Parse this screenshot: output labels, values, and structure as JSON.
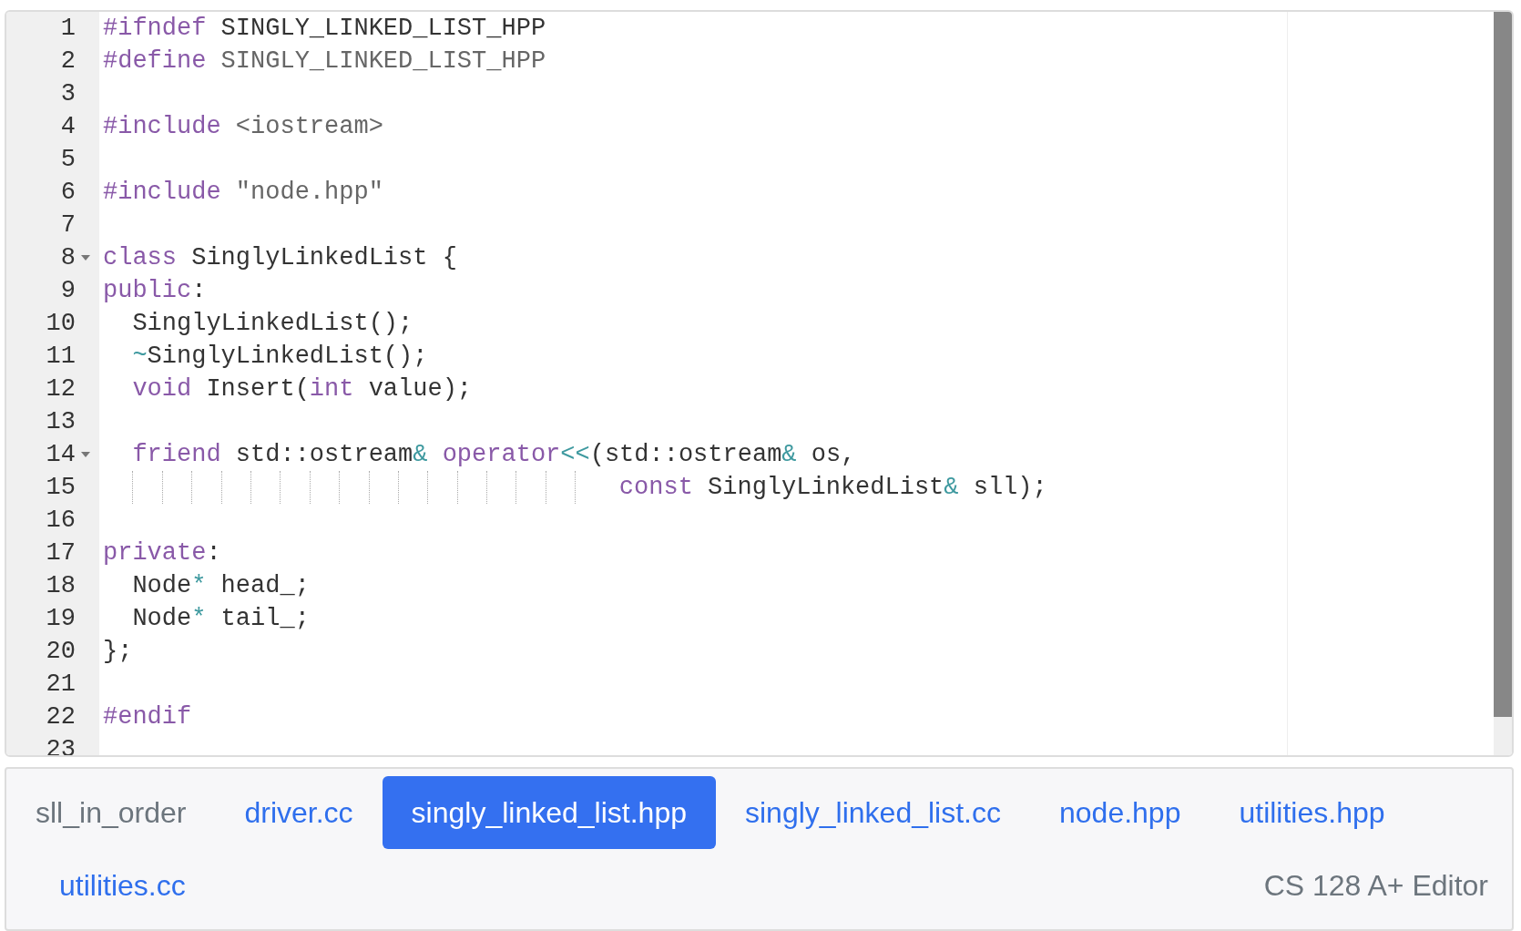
{
  "editor": {
    "lines": [
      {
        "number": "1",
        "fold": false,
        "indent_guides": false,
        "tokens": [
          {
            "kind": "keyword",
            "text": "#ifndef"
          },
          {
            "kind": "plain",
            "text": " SINGLY_LINKED_LIST_HPP"
          }
        ]
      },
      {
        "number": "2",
        "fold": false,
        "indent_guides": false,
        "tokens": [
          {
            "kind": "keyword",
            "text": "#define"
          },
          {
            "kind": "meta",
            "text": " SINGLY_LINKED_LIST_HPP"
          }
        ]
      },
      {
        "number": "3",
        "fold": false,
        "indent_guides": false
      },
      {
        "number": "4",
        "fold": false,
        "indent_guides": false,
        "tokens": [
          {
            "kind": "keyword",
            "text": "#include"
          },
          {
            "kind": "meta",
            "text": " <iostream>"
          }
        ]
      },
      {
        "number": "5",
        "fold": false,
        "indent_guides": false
      },
      {
        "number": "6",
        "fold": false,
        "indent_guides": false,
        "tokens": [
          {
            "kind": "keyword",
            "text": "#include"
          },
          {
            "kind": "meta",
            "text": " \"node.hpp\""
          }
        ]
      },
      {
        "number": "7",
        "fold": false,
        "indent_guides": false
      },
      {
        "number": "8",
        "fold": true,
        "indent_guides": false,
        "tokens": [
          {
            "kind": "keyword",
            "text": "class"
          },
          {
            "kind": "plain",
            "text": " SinglyLinkedList {"
          }
        ]
      },
      {
        "number": "9",
        "fold": false,
        "indent_guides": false,
        "tokens": [
          {
            "kind": "keyword",
            "text": "public"
          },
          {
            "kind": "plain",
            "text": ":"
          }
        ]
      },
      {
        "number": "10",
        "fold": false,
        "indent_guides": false,
        "tokens": [
          {
            "kind": "plain",
            "text": "  SinglyLinkedList();"
          }
        ]
      },
      {
        "number": "11",
        "fold": false,
        "indent_guides": false,
        "tokens": [
          {
            "kind": "operator",
            "text": "  ~"
          },
          {
            "kind": "plain",
            "text": "SinglyLinkedList();"
          }
        ]
      },
      {
        "number": "12",
        "fold": false,
        "indent_guides": false,
        "tokens": [
          {
            "kind": "keyword",
            "text": "  void"
          },
          {
            "kind": "plain",
            "text": " Insert("
          },
          {
            "kind": "keyword",
            "text": "int"
          },
          {
            "kind": "plain",
            "text": " value);"
          }
        ]
      },
      {
        "number": "13",
        "fold": false,
        "indent_guides": false
      },
      {
        "number": "14",
        "fold": true,
        "indent_guides": false,
        "tokens": [
          {
            "kind": "keyword",
            "text": "  friend"
          },
          {
            "kind": "plain",
            "text": " std::ostream"
          },
          {
            "kind": "operator",
            "text": "& "
          },
          {
            "kind": "keyword",
            "text": "operator"
          },
          {
            "kind": "operator",
            "text": "<<"
          },
          {
            "kind": "plain",
            "text": "(std::ostream"
          },
          {
            "kind": "operator",
            "text": "&"
          },
          {
            "kind": "plain",
            "text": " os,"
          }
        ]
      },
      {
        "number": "15",
        "fold": false,
        "indent_guides": true,
        "tokens": [
          {
            "kind": "keyword",
            "text": "                                   const"
          },
          {
            "kind": "plain",
            "text": " SinglyLinkedList"
          },
          {
            "kind": "operator",
            "text": "&"
          },
          {
            "kind": "plain",
            "text": " sll);"
          }
        ]
      },
      {
        "number": "16",
        "fold": false,
        "indent_guides": false
      },
      {
        "number": "17",
        "fold": false,
        "indent_guides": false,
        "tokens": [
          {
            "kind": "keyword",
            "text": "private"
          },
          {
            "kind": "plain",
            "text": ":"
          }
        ]
      },
      {
        "number": "18",
        "fold": false,
        "indent_guides": false,
        "tokens": [
          {
            "kind": "plain",
            "text": "  Node"
          },
          {
            "kind": "operator",
            "text": "*"
          },
          {
            "kind": "plain",
            "text": " head_;"
          }
        ]
      },
      {
        "number": "19",
        "fold": false,
        "indent_guides": false,
        "tokens": [
          {
            "kind": "plain",
            "text": "  Node"
          },
          {
            "kind": "operator",
            "text": "*"
          },
          {
            "kind": "plain",
            "text": " tail_;"
          }
        ]
      },
      {
        "number": "20",
        "fold": false,
        "indent_guides": false,
        "tokens": [
          {
            "kind": "plain",
            "text": "};"
          }
        ]
      },
      {
        "number": "21",
        "fold": false,
        "indent_guides": false
      },
      {
        "number": "22",
        "fold": false,
        "indent_guides": false,
        "tokens": [
          {
            "kind": "keyword",
            "text": "#endif"
          }
        ]
      },
      {
        "number": "23",
        "fold": false,
        "indent_guides": false
      }
    ]
  },
  "project": "sll_in_order",
  "tabs": [
    {
      "label": "driver.cc",
      "selected": false
    },
    {
      "label": "singly_linked_list.hpp",
      "selected": true
    },
    {
      "label": "singly_linked_list.cc",
      "selected": false
    },
    {
      "label": "node.hpp",
      "selected": false
    },
    {
      "label": "utilities.hpp",
      "selected": false
    },
    {
      "label": "utilities.cc",
      "selected": false
    }
  ],
  "footer_text": "CS 128 A+ Editor"
}
